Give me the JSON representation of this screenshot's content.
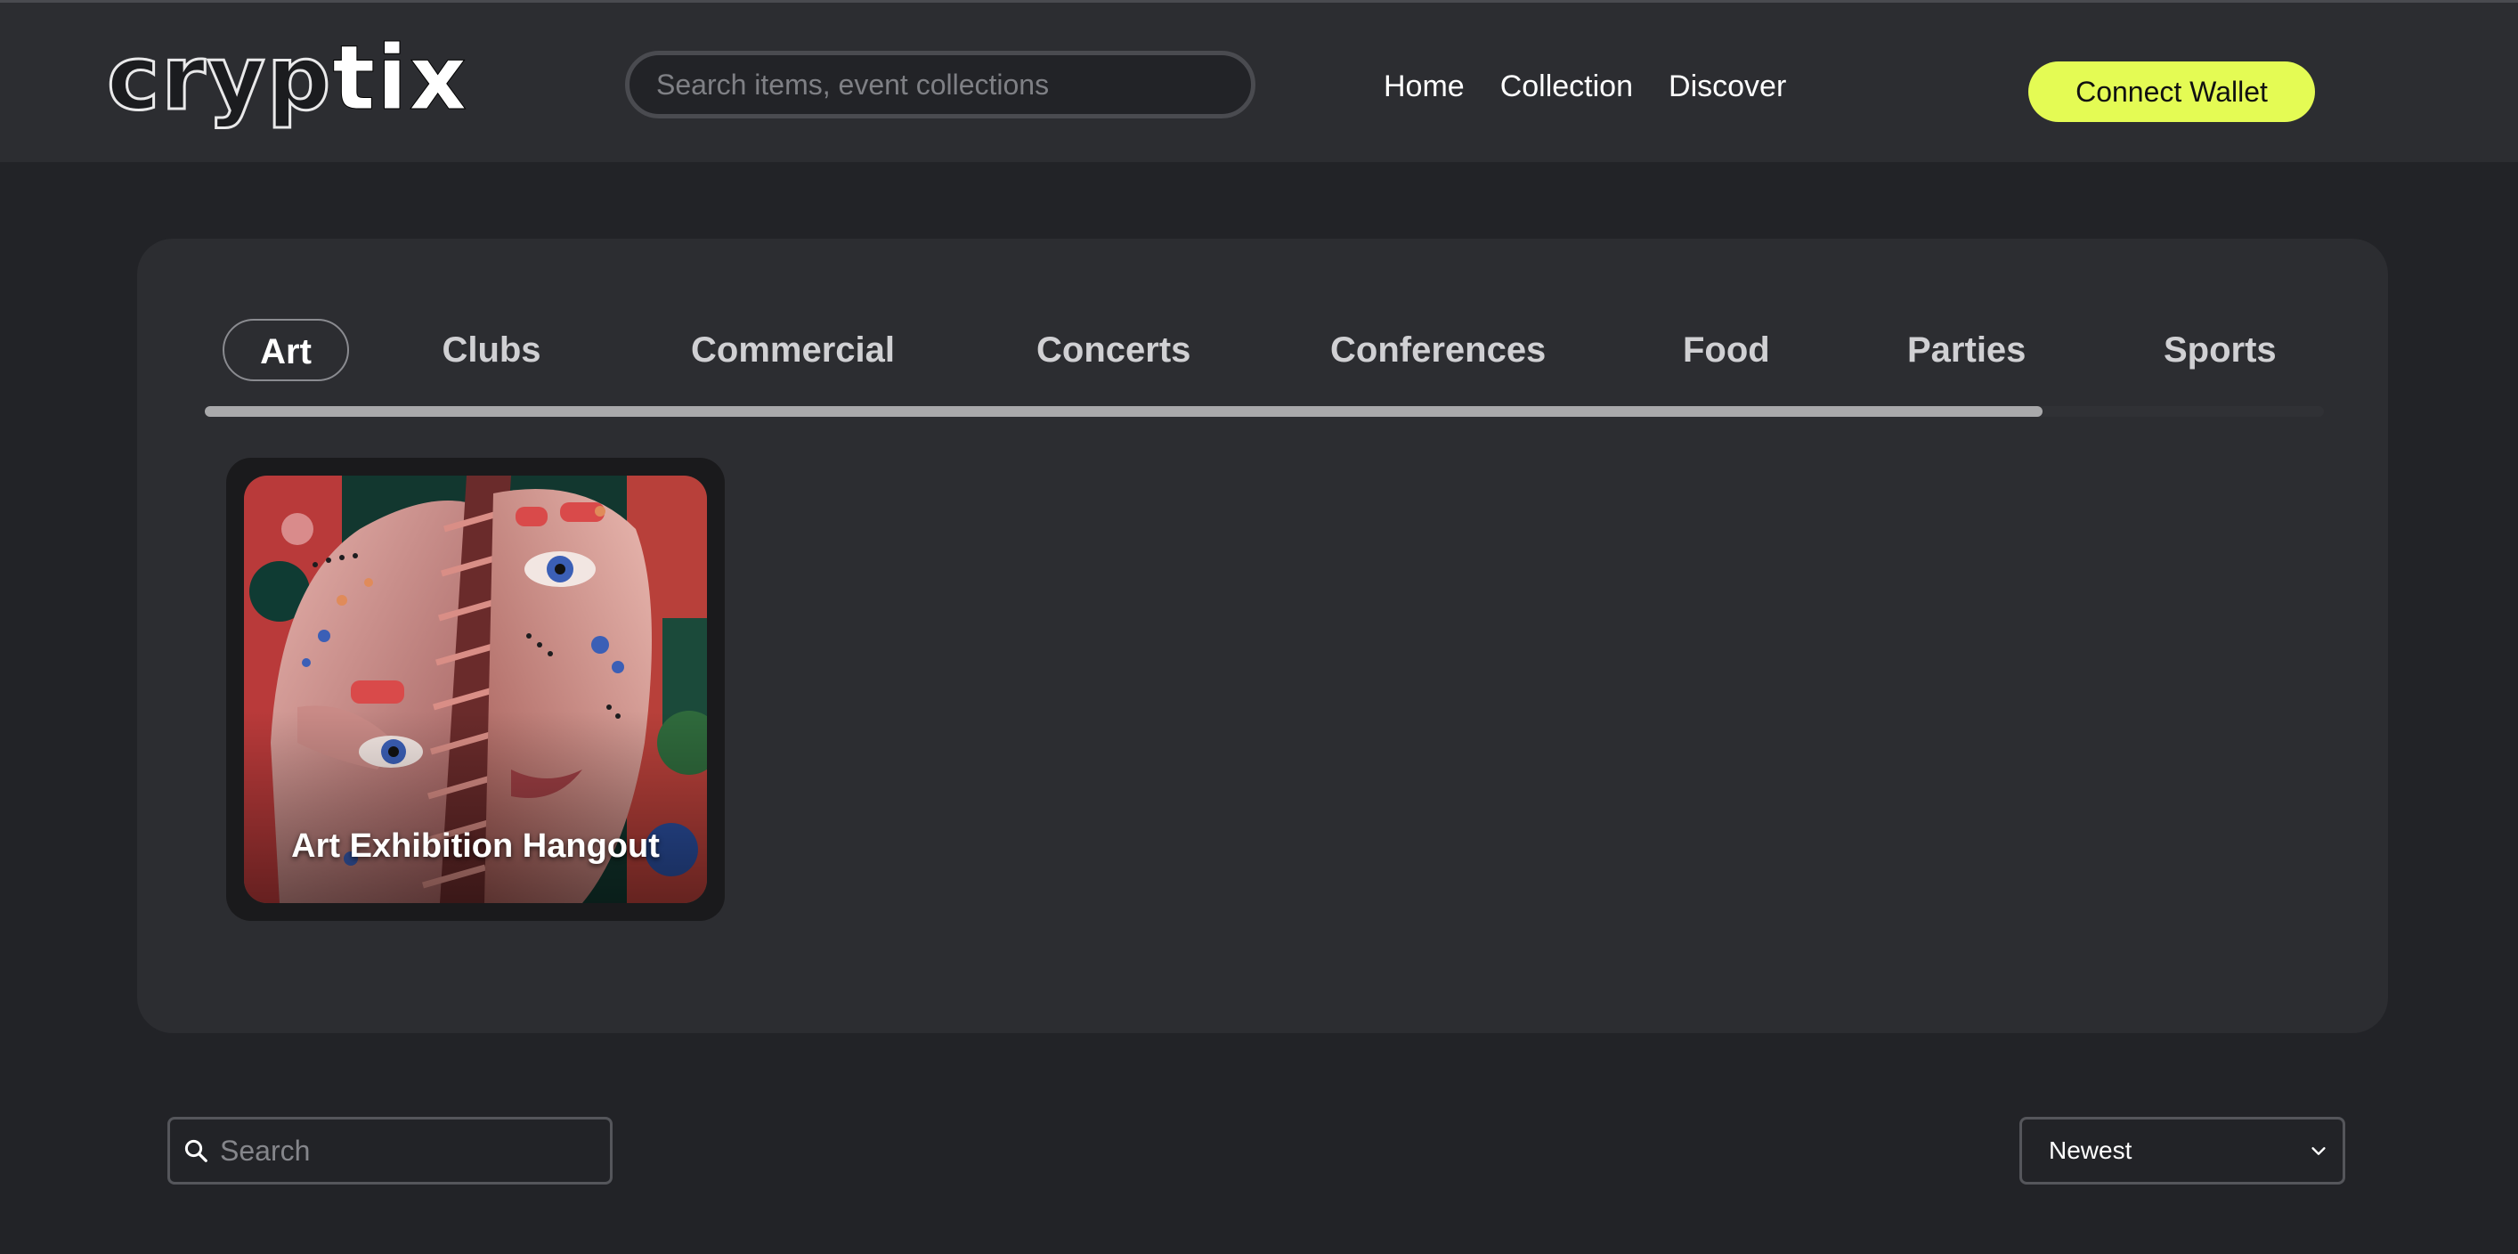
{
  "brand": {
    "logo_outline": "cryp",
    "logo_solid": "tix"
  },
  "header": {
    "search_placeholder": "Search items, event collections",
    "nav": [
      "Home",
      "Collection",
      "Discover"
    ],
    "connect_label": "Connect Wallet",
    "accent_color": "#e4fb54"
  },
  "categories": {
    "active": "Art",
    "tabs": [
      "Art",
      "Clubs",
      "Commercial",
      "Concerts",
      "Conferences",
      "Food",
      "Parties",
      "Sports"
    ]
  },
  "events": [
    {
      "title": "Art Exhibition Hangout"
    }
  ],
  "filters": {
    "search_placeholder": "Search",
    "sort_value": "Newest"
  },
  "icons": {
    "search": "search-icon",
    "dropdown": "chevron-down-icon"
  }
}
